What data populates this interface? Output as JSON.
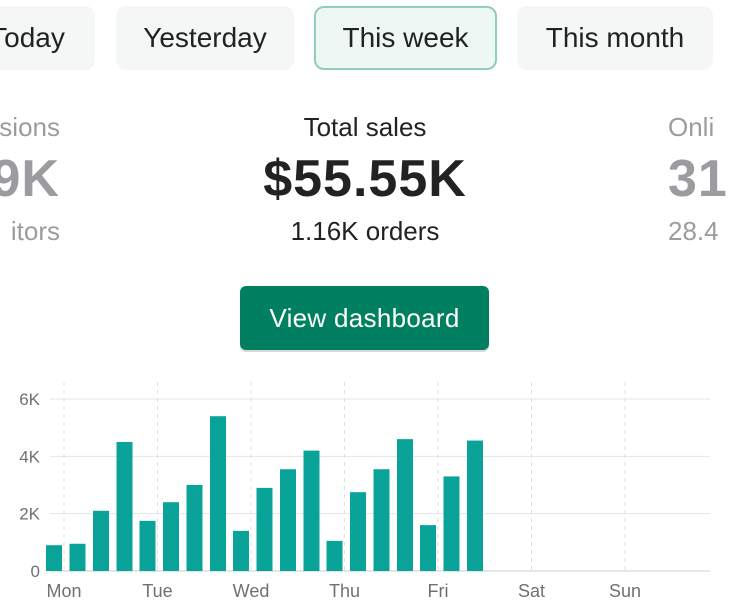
{
  "tabs": [
    {
      "label": "Today",
      "active": false
    },
    {
      "label": "Yesterday",
      "active": false
    },
    {
      "label": "This week",
      "active": true
    },
    {
      "label": "This month",
      "active": false
    }
  ],
  "metrics": {
    "left": {
      "label": "sions",
      "value": "9K",
      "sub": "itors"
    },
    "center": {
      "label": "Total sales",
      "value": "$55.55K",
      "sub": "1.16K orders"
    },
    "right": {
      "label": "Onli",
      "value": "31",
      "sub": "28.4"
    }
  },
  "button": {
    "label": "View dashboard"
  },
  "colors": {
    "accent": "#008060",
    "bar": "#0aa39a"
  },
  "chart_data": {
    "type": "bar",
    "title": "",
    "xlabel": "",
    "ylabel": "",
    "ylim": [
      0,
      6000
    ],
    "yticks": [
      0,
      2000,
      4000,
      6000
    ],
    "ytick_labels": [
      "0",
      "2K",
      "4K",
      "6K"
    ],
    "day_labels": [
      "Mon",
      "Tue",
      "Wed",
      "Thu",
      "Fri",
      "Sat",
      "Sun"
    ],
    "bars_per_day": 4,
    "values": [
      900,
      950,
      2100,
      4500,
      1750,
      2400,
      3000,
      5400,
      1400,
      2900,
      3550,
      4200,
      1050,
      2750,
      3550,
      4600,
      1600,
      3300,
      4550
    ],
    "grid": true
  }
}
